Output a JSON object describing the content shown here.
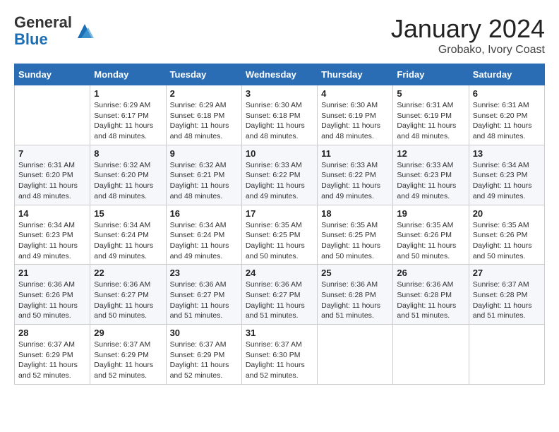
{
  "header": {
    "logo_line1": "General",
    "logo_line2": "Blue",
    "month_title": "January 2024",
    "subtitle": "Grobako, Ivory Coast"
  },
  "days_of_week": [
    "Sunday",
    "Monday",
    "Tuesday",
    "Wednesday",
    "Thursday",
    "Friday",
    "Saturday"
  ],
  "weeks": [
    [
      {
        "day": "",
        "info": ""
      },
      {
        "day": "1",
        "info": "Sunrise: 6:29 AM\nSunset: 6:17 PM\nDaylight: 11 hours and 48 minutes."
      },
      {
        "day": "2",
        "info": "Sunrise: 6:29 AM\nSunset: 6:18 PM\nDaylight: 11 hours and 48 minutes."
      },
      {
        "day": "3",
        "info": "Sunrise: 6:30 AM\nSunset: 6:18 PM\nDaylight: 11 hours and 48 minutes."
      },
      {
        "day": "4",
        "info": "Sunrise: 6:30 AM\nSunset: 6:19 PM\nDaylight: 11 hours and 48 minutes."
      },
      {
        "day": "5",
        "info": "Sunrise: 6:31 AM\nSunset: 6:19 PM\nDaylight: 11 hours and 48 minutes."
      },
      {
        "day": "6",
        "info": "Sunrise: 6:31 AM\nSunset: 6:20 PM\nDaylight: 11 hours and 48 minutes."
      }
    ],
    [
      {
        "day": "7",
        "info": "Sunrise: 6:31 AM\nSunset: 6:20 PM\nDaylight: 11 hours and 48 minutes."
      },
      {
        "day": "8",
        "info": "Sunrise: 6:32 AM\nSunset: 6:20 PM\nDaylight: 11 hours and 48 minutes."
      },
      {
        "day": "9",
        "info": "Sunrise: 6:32 AM\nSunset: 6:21 PM\nDaylight: 11 hours and 48 minutes."
      },
      {
        "day": "10",
        "info": "Sunrise: 6:33 AM\nSunset: 6:22 PM\nDaylight: 11 hours and 49 minutes."
      },
      {
        "day": "11",
        "info": "Sunrise: 6:33 AM\nSunset: 6:22 PM\nDaylight: 11 hours and 49 minutes."
      },
      {
        "day": "12",
        "info": "Sunrise: 6:33 AM\nSunset: 6:23 PM\nDaylight: 11 hours and 49 minutes."
      },
      {
        "day": "13",
        "info": "Sunrise: 6:34 AM\nSunset: 6:23 PM\nDaylight: 11 hours and 49 minutes."
      }
    ],
    [
      {
        "day": "14",
        "info": "Sunrise: 6:34 AM\nSunset: 6:23 PM\nDaylight: 11 hours and 49 minutes."
      },
      {
        "day": "15",
        "info": "Sunrise: 6:34 AM\nSunset: 6:24 PM\nDaylight: 11 hours and 49 minutes."
      },
      {
        "day": "16",
        "info": "Sunrise: 6:34 AM\nSunset: 6:24 PM\nDaylight: 11 hours and 49 minutes."
      },
      {
        "day": "17",
        "info": "Sunrise: 6:35 AM\nSunset: 6:25 PM\nDaylight: 11 hours and 50 minutes."
      },
      {
        "day": "18",
        "info": "Sunrise: 6:35 AM\nSunset: 6:25 PM\nDaylight: 11 hours and 50 minutes."
      },
      {
        "day": "19",
        "info": "Sunrise: 6:35 AM\nSunset: 6:26 PM\nDaylight: 11 hours and 50 minutes."
      },
      {
        "day": "20",
        "info": "Sunrise: 6:35 AM\nSunset: 6:26 PM\nDaylight: 11 hours and 50 minutes."
      }
    ],
    [
      {
        "day": "21",
        "info": "Sunrise: 6:36 AM\nSunset: 6:26 PM\nDaylight: 11 hours and 50 minutes."
      },
      {
        "day": "22",
        "info": "Sunrise: 6:36 AM\nSunset: 6:27 PM\nDaylight: 11 hours and 50 minutes."
      },
      {
        "day": "23",
        "info": "Sunrise: 6:36 AM\nSunset: 6:27 PM\nDaylight: 11 hours and 51 minutes."
      },
      {
        "day": "24",
        "info": "Sunrise: 6:36 AM\nSunset: 6:27 PM\nDaylight: 11 hours and 51 minutes."
      },
      {
        "day": "25",
        "info": "Sunrise: 6:36 AM\nSunset: 6:28 PM\nDaylight: 11 hours and 51 minutes."
      },
      {
        "day": "26",
        "info": "Sunrise: 6:36 AM\nSunset: 6:28 PM\nDaylight: 11 hours and 51 minutes."
      },
      {
        "day": "27",
        "info": "Sunrise: 6:37 AM\nSunset: 6:28 PM\nDaylight: 11 hours and 51 minutes."
      }
    ],
    [
      {
        "day": "28",
        "info": "Sunrise: 6:37 AM\nSunset: 6:29 PM\nDaylight: 11 hours and 52 minutes."
      },
      {
        "day": "29",
        "info": "Sunrise: 6:37 AM\nSunset: 6:29 PM\nDaylight: 11 hours and 52 minutes."
      },
      {
        "day": "30",
        "info": "Sunrise: 6:37 AM\nSunset: 6:29 PM\nDaylight: 11 hours and 52 minutes."
      },
      {
        "day": "31",
        "info": "Sunrise: 6:37 AM\nSunset: 6:30 PM\nDaylight: 11 hours and 52 minutes."
      },
      {
        "day": "",
        "info": ""
      },
      {
        "day": "",
        "info": ""
      },
      {
        "day": "",
        "info": ""
      }
    ]
  ]
}
